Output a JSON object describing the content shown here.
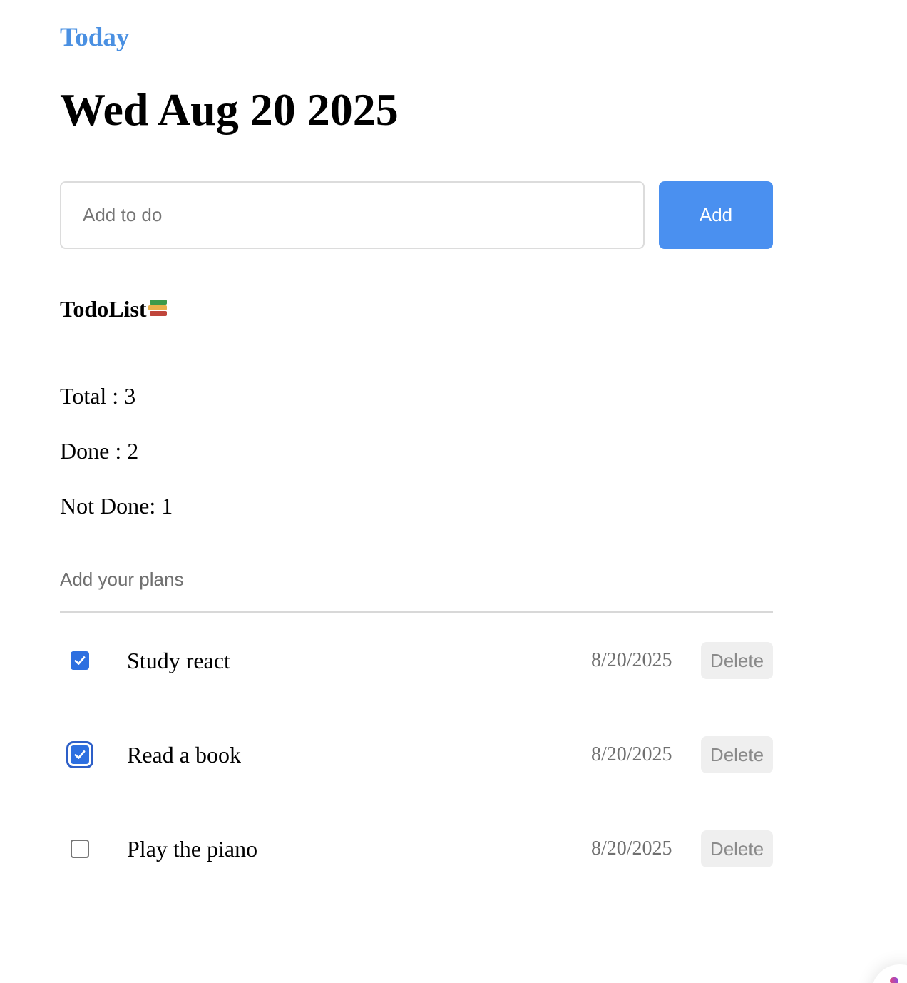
{
  "header": {
    "today_label": "Today",
    "date_title": "Wed Aug 20 2025"
  },
  "add_form": {
    "input_placeholder": "Add to do",
    "input_value": "",
    "add_button_label": "Add"
  },
  "todo_section": {
    "title": "TodoList",
    "title_icon": "books-emoji-icon",
    "stats": {
      "total": "Total : 3",
      "done": "Done : 2",
      "not_done": "Not Done: 1"
    },
    "plans_label": "Add your plans"
  },
  "todos": [
    {
      "text": "Study react",
      "date": "8/20/2025",
      "done": true,
      "delete_label": "Delete"
    },
    {
      "text": "Read a book",
      "date": "8/20/2025",
      "done": true,
      "delete_label": "Delete"
    },
    {
      "text": "Play the piano",
      "date": "8/20/2025",
      "done": false,
      "delete_label": "Delete"
    }
  ],
  "colors": {
    "accent": "#4a90e2",
    "button_blue": "#4a90f0",
    "checkbox_checked": "#2d6fe0",
    "muted_text": "#707070",
    "delete_bg": "#efefef"
  }
}
